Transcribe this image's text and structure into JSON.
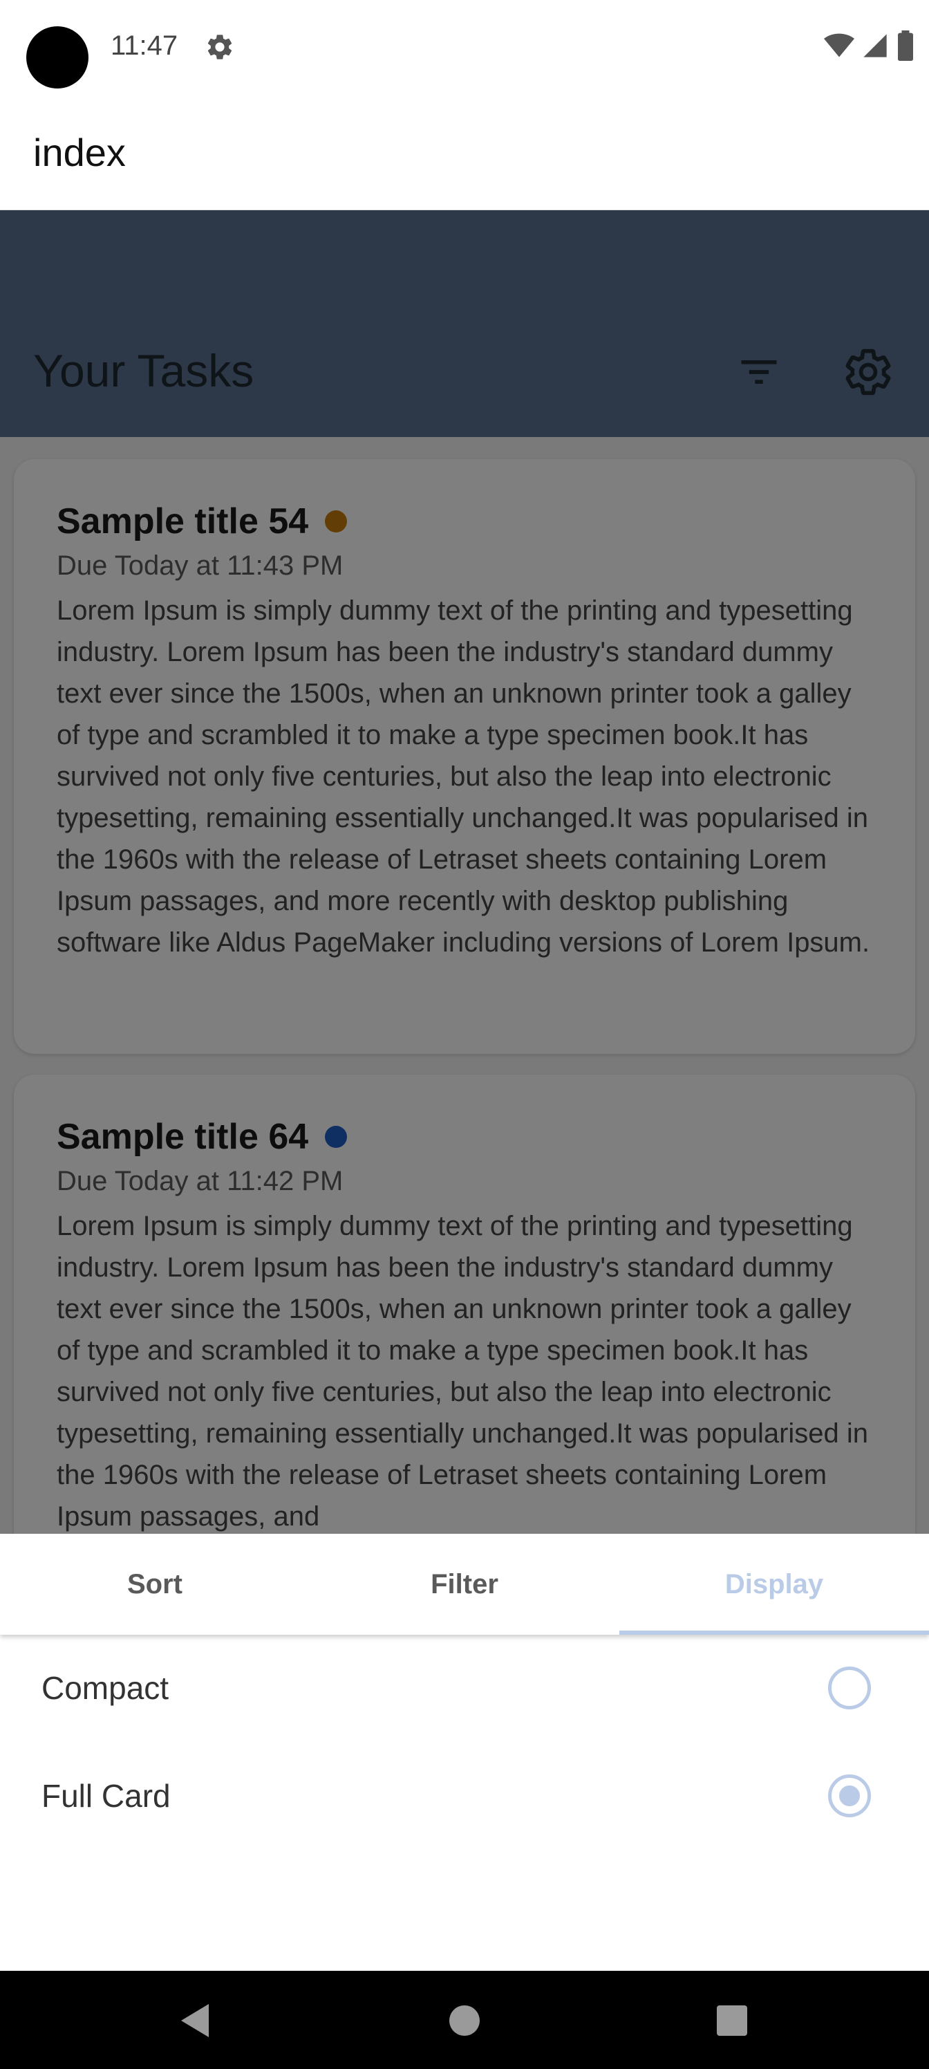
{
  "status_bar": {
    "time": "11:47"
  },
  "app_bar": {
    "title": "index"
  },
  "tasks_header": {
    "title": "Your Tasks"
  },
  "tasks": [
    {
      "title": "Sample title 54",
      "due": "Due Today at 11:43 PM",
      "dot_color": "#c47c0c",
      "description": "Lorem Ipsum is simply dummy text of the printing and typesetting industry. Lorem Ipsum has been the industry's standard dummy text ever since the 1500s, when an unknown printer took a galley of type and scrambled it to make a type specimen book.It has survived not only five centuries, but also the leap into electronic typesetting, remaining essentially unchanged.It was popularised in the 1960s with the release of Letraset sheets containing Lorem Ipsum passages, and more recently with desktop publishing software like Aldus PageMaker including versions of Lorem Ipsum."
    },
    {
      "title": "Sample title 64",
      "due": "Due Today at 11:42 PM",
      "dot_color": "#1f5fc4",
      "description": "Lorem Ipsum is simply dummy text of the printing and typesetting industry. Lorem Ipsum has been the industry's standard dummy text ever since the 1500s, when an unknown printer took a galley of type and scrambled it to make a type specimen book.It has survived not only five centuries, but also the leap into electronic typesetting, remaining essentially unchanged.It was popularised in the 1960s with the release of Letraset sheets containing Lorem Ipsum passages, and"
    }
  ],
  "sheet": {
    "tabs": [
      {
        "label": "Sort",
        "active": false
      },
      {
        "label": "Filter",
        "active": false
      },
      {
        "label": "Display",
        "active": true
      }
    ],
    "options": [
      {
        "label": "Compact",
        "selected": false
      },
      {
        "label": "Full Card",
        "selected": true
      }
    ]
  },
  "colors": {
    "header_bg": "#5b7390",
    "accent": "#b9cbe6",
    "scrim": "rgba(0,0,0,0.5)"
  },
  "icons": [
    "gear-icon",
    "wifi-icon",
    "cellular-signal-icon",
    "battery-icon",
    "filter-icon",
    "settings-gear-icon",
    "back-icon",
    "home-icon",
    "recents-icon"
  ]
}
